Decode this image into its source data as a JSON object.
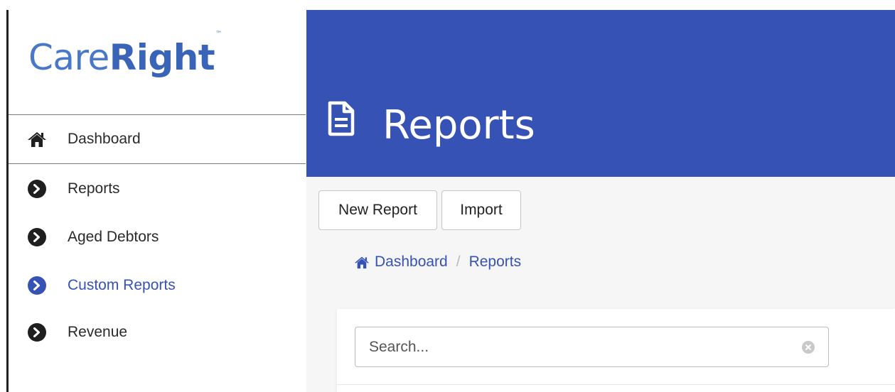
{
  "brand": {
    "part1": "Care",
    "part2": "Right",
    "trademark": "™"
  },
  "sidebar": {
    "items": [
      {
        "label": "Dashboard",
        "icon": "home-icon"
      },
      {
        "label": "Reports",
        "icon": "chevron-circle-right-icon"
      },
      {
        "label": "Aged Debtors",
        "icon": "chevron-circle-right-icon"
      },
      {
        "label": "Custom Reports",
        "icon": "chevron-circle-right-icon",
        "active": true
      },
      {
        "label": "Revenue",
        "icon": "chevron-circle-right-icon"
      }
    ]
  },
  "header": {
    "title": "Reports",
    "icon": "document-icon"
  },
  "toolbar": {
    "new_report_label": "New Report",
    "import_label": "Import"
  },
  "breadcrumb": {
    "home": "Dashboard",
    "separator": "/",
    "current": "Reports"
  },
  "search": {
    "placeholder": "Search...",
    "value": ""
  },
  "colors": {
    "accent": "#3652b5",
    "text": "#2a2a2a",
    "background": "#f6f6f6"
  }
}
